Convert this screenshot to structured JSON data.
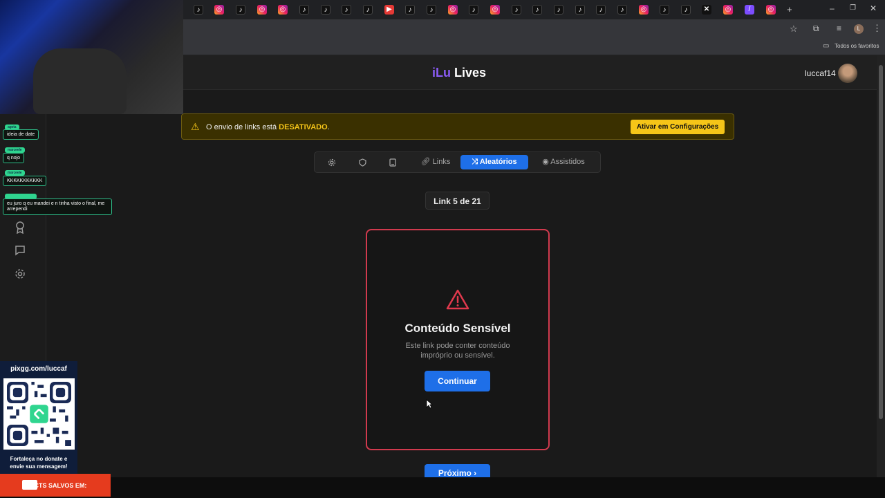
{
  "browser": {
    "bookmarks_label": "Todos os favoritos",
    "profile_initial": "L"
  },
  "app": {
    "logo_part1": "iLu",
    "logo_part2": " Lives",
    "username": "luccaf14"
  },
  "alert": {
    "text_prefix": "O envio de links está ",
    "text_bold": "DESATIVADO",
    "text_suffix": ".",
    "button": "Ativar em Configurações"
  },
  "tabs": {
    "links": "Links",
    "random": "Aleatórios",
    "watched": "Assistidos"
  },
  "counter": "Link 5 de 21",
  "card": {
    "title": "Conteúdo Sensível",
    "description": "Este link pode conter conteúdo impróprio ou sensível.",
    "continue": "Continuar"
  },
  "next_button": "Próximo ›",
  "overlay": {
    "chat": [
      {
        "tag": "agota",
        "text": "ideia de date"
      },
      {
        "tag": "marceele",
        "text": "q nojo"
      },
      {
        "tag": "marceele",
        "text": "KKKKKKKKKKK"
      },
      {
        "tag": "",
        "text": "eu juro q eu mandei e n tinha visto o final, me arrependi"
      }
    ],
    "qr_title": "pixgg.com/luccaf",
    "qr_caption": "Fortaleça no donate e envie sua mensagem!",
    "facts": "FACTS SALVOS EM:"
  },
  "colors": {
    "accent": "#1e6fe8",
    "danger_border": "#d13a4e",
    "warning": "#f5c518",
    "logo_purple": "#8b5cf6"
  }
}
